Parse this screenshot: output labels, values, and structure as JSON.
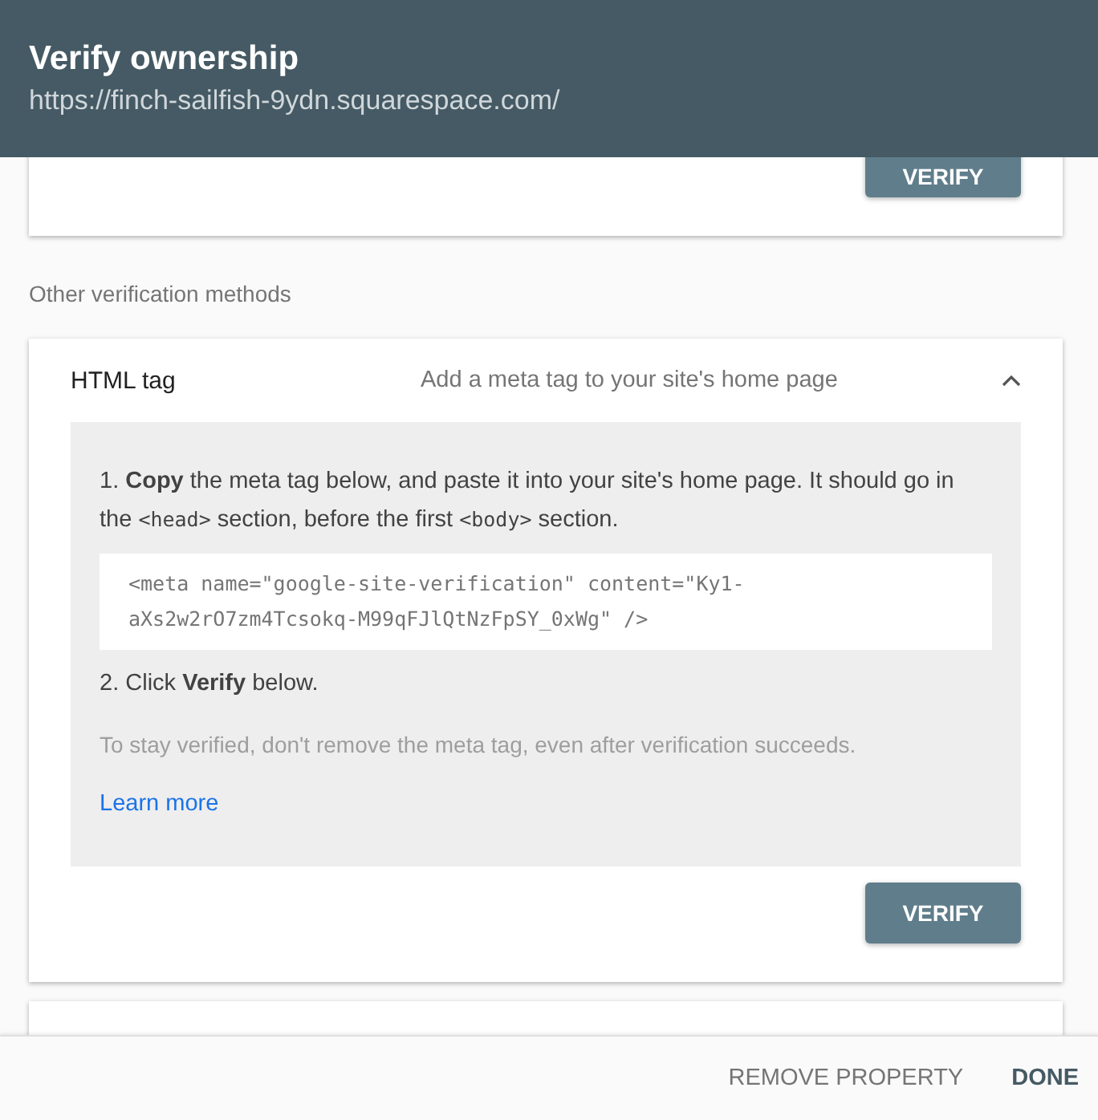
{
  "header": {
    "title": "Verify ownership",
    "url": "https://finch-sailfish-9ydn.squarespace.com/"
  },
  "previous_method": {
    "button": "VERIFY"
  },
  "section_label": "Other verification methods",
  "methods": [
    {
      "name": "HTML tag",
      "description": "Add a meta tag to your site's home page",
      "expanded": true,
      "steps": [
        [
          {
            "kind": "text",
            "text": "1. "
          },
          {
            "kind": "bold",
            "text": "Copy"
          },
          {
            "kind": "text",
            "text": " the meta tag below, and paste it into your site's home page. It should go in the "
          },
          {
            "kind": "code",
            "text": "<head>"
          },
          {
            "kind": "text",
            "text": " section, before the first "
          },
          {
            "kind": "code",
            "text": "<body>"
          },
          {
            "kind": "text",
            "text": " section."
          }
        ],
        [
          {
            "kind": "text",
            "text": "2. Click "
          },
          {
            "kind": "bold",
            "text": "Verify"
          },
          {
            "kind": "text",
            "text": " below."
          }
        ]
      ],
      "code": "<meta name=\"google-site-verification\" content=\"Ky1-aXs2w2rO7zm4Tcsokq-M99qFJlQtNzFpSY_0xWg\" />",
      "note": "To stay verified, don't remove the meta tag, even after verification succeeds.",
      "link": "Learn more",
      "button": "VERIFY"
    }
  ],
  "footer": {
    "buttons": [
      {
        "label": "REMOVE PROPERTY",
        "primary": false
      },
      {
        "label": "DONE",
        "primary": true
      }
    ]
  }
}
